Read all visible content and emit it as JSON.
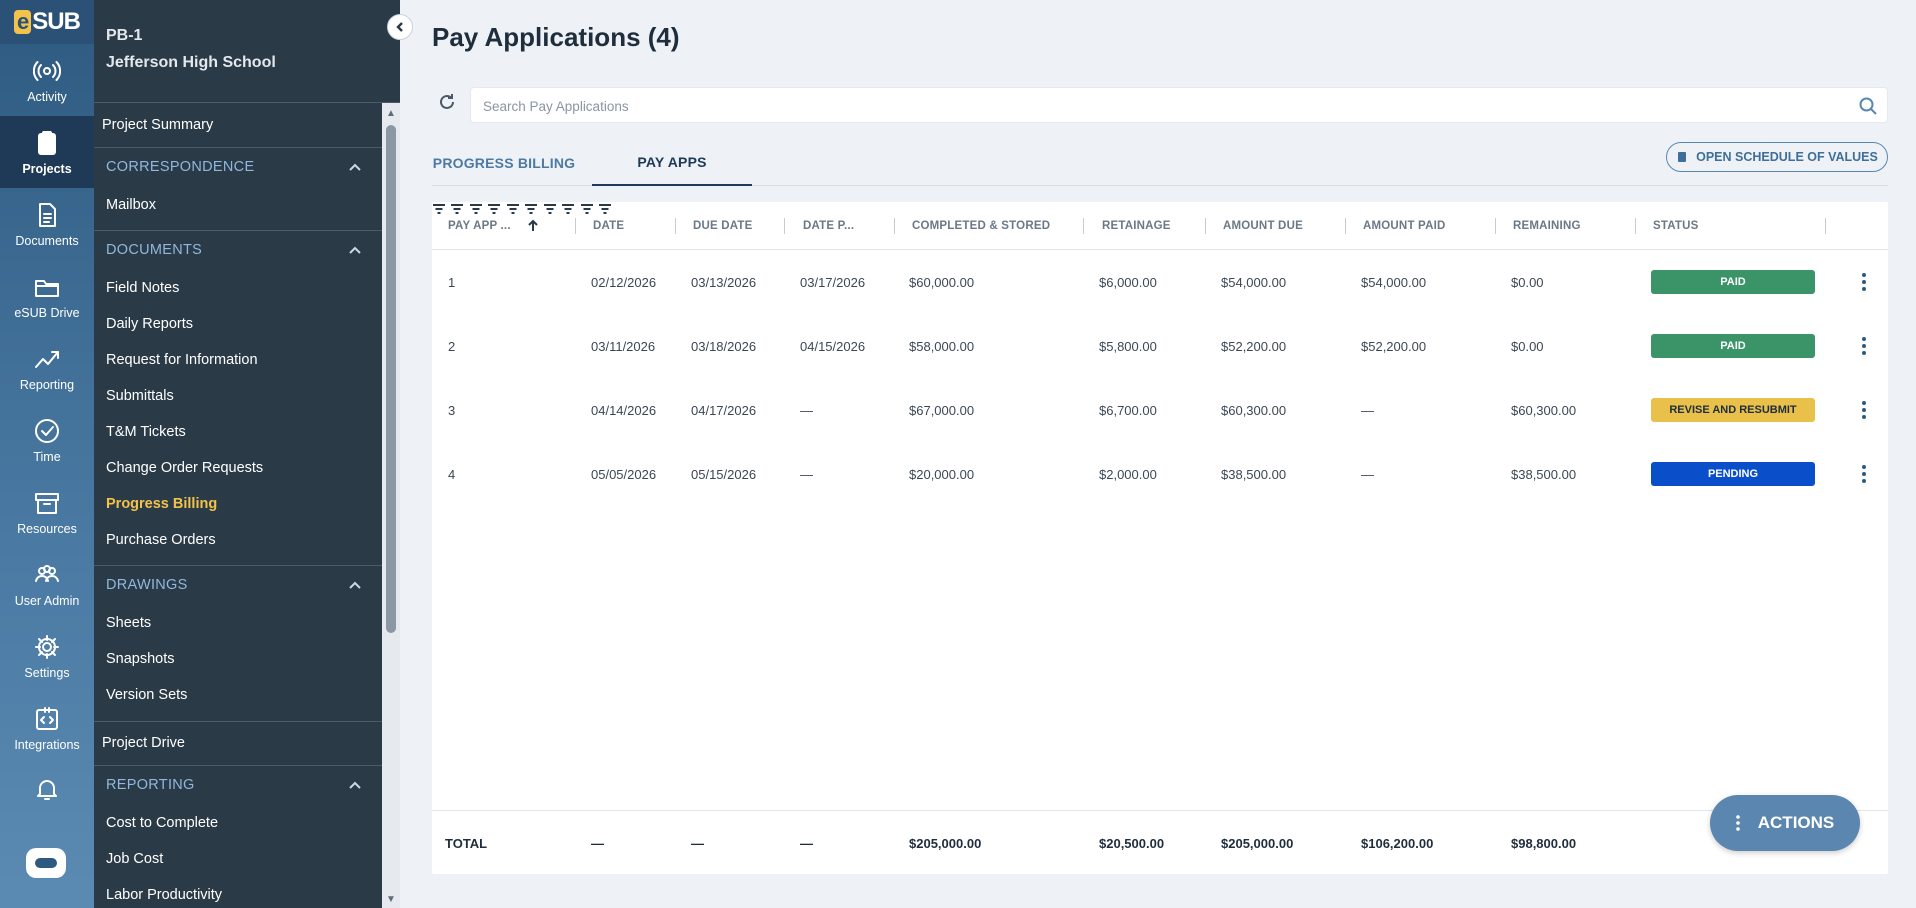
{
  "brand": {
    "logo_e": "e",
    "logo_rest": "SUB"
  },
  "rail": [
    {
      "label": "Activity",
      "icon": "activity-icon"
    },
    {
      "label": "Projects",
      "icon": "clipboard-icon",
      "active": true
    },
    {
      "label": "Documents",
      "icon": "document-icon"
    },
    {
      "label": "eSUB Drive",
      "icon": "folder-icon"
    },
    {
      "label": "Reporting",
      "icon": "chart-icon"
    },
    {
      "label": "Time",
      "icon": "clock-icon"
    },
    {
      "label": "Resources",
      "icon": "archive-icon"
    },
    {
      "label": "User Admin",
      "icon": "users-icon"
    },
    {
      "label": "Settings",
      "icon": "gear-icon"
    },
    {
      "label": "Integrations",
      "icon": "code-icon"
    }
  ],
  "project": {
    "code": "PB-1",
    "name": "Jefferson High School",
    "summary": "Project Summary",
    "correspondence": {
      "title": "CORRESPONDENCE",
      "items": [
        "Mailbox"
      ]
    },
    "documents": {
      "title": "DOCUMENTS",
      "items": [
        "Field Notes",
        "Daily Reports",
        "Request for Information",
        "Submittals",
        "T&M Tickets",
        "Change Order Requests",
        "Progress Billing",
        "Purchase Orders"
      ]
    },
    "drawings": {
      "title": "DRAWINGS",
      "items": [
        "Sheets",
        "Snapshots",
        "Version Sets"
      ]
    },
    "drive": "Project Drive",
    "reporting": {
      "title": "REPORTING",
      "items": [
        "Cost to Complete",
        "Job Cost",
        "Labor Productivity"
      ]
    }
  },
  "page": {
    "title": "Pay Applications (4)"
  },
  "search": {
    "placeholder": "Search Pay Applications",
    "value": ""
  },
  "tabs": {
    "progress_billing": "PROGRESS BILLING",
    "pay_apps": "PAY APPS"
  },
  "sov_button": "OPEN SCHEDULE OF VALUES",
  "table": {
    "columns": [
      "PAY APP ...",
      "DATE",
      "DUE DATE",
      "DATE P...",
      "COMPLETED & STORED",
      "RETAINAGE",
      "AMOUNT DUE",
      "AMOUNT PAID",
      "REMAINING",
      "STATUS"
    ],
    "rows": [
      {
        "id": "1",
        "date": "02/12/2026",
        "due": "03/13/2026",
        "paid_date": "03/17/2026",
        "completed": "$60,000.00",
        "retainage": "$6,000.00",
        "amount_due": "$54,000.00",
        "amount_paid": "$54,000.00",
        "remaining": "$0.00",
        "status": "PAID"
      },
      {
        "id": "2",
        "date": "03/11/2026",
        "due": "03/18/2026",
        "paid_date": "04/15/2026",
        "completed": "$58,000.00",
        "retainage": "$5,800.00",
        "amount_due": "$52,200.00",
        "amount_paid": "$52,200.00",
        "remaining": "$0.00",
        "status": "PAID"
      },
      {
        "id": "3",
        "date": "04/14/2026",
        "due": "04/17/2026",
        "paid_date": "—",
        "completed": "$67,000.00",
        "retainage": "$6,700.00",
        "amount_due": "$60,300.00",
        "amount_paid": "—",
        "remaining": "$60,300.00",
        "status": "REVISE AND RESUBMIT"
      },
      {
        "id": "4",
        "date": "05/05/2026",
        "due": "05/15/2026",
        "paid_date": "—",
        "completed": "$20,000.00",
        "retainage": "$2,000.00",
        "amount_due": "$38,500.00",
        "amount_paid": "—",
        "remaining": "$38,500.00",
        "status": "PENDING"
      }
    ],
    "totals": {
      "label": "TOTAL",
      "date": "—",
      "due": "—",
      "paid_date": "—",
      "completed": "$205,000.00",
      "retainage": "$20,500.00",
      "amount_due": "$205,000.00",
      "amount_paid": "$106,200.00",
      "remaining": "$98,800.00"
    }
  },
  "status_colors": {
    "PAID": {
      "bg": "#3a9467",
      "fg": "#ffffff"
    },
    "REVISE AND RESUBMIT": {
      "bg": "#e8c04a",
      "fg": "#1f2d3d"
    },
    "PENDING": {
      "bg": "#0a4fc9",
      "fg": "#ffffff"
    }
  },
  "actions_button": "ACTIONS"
}
